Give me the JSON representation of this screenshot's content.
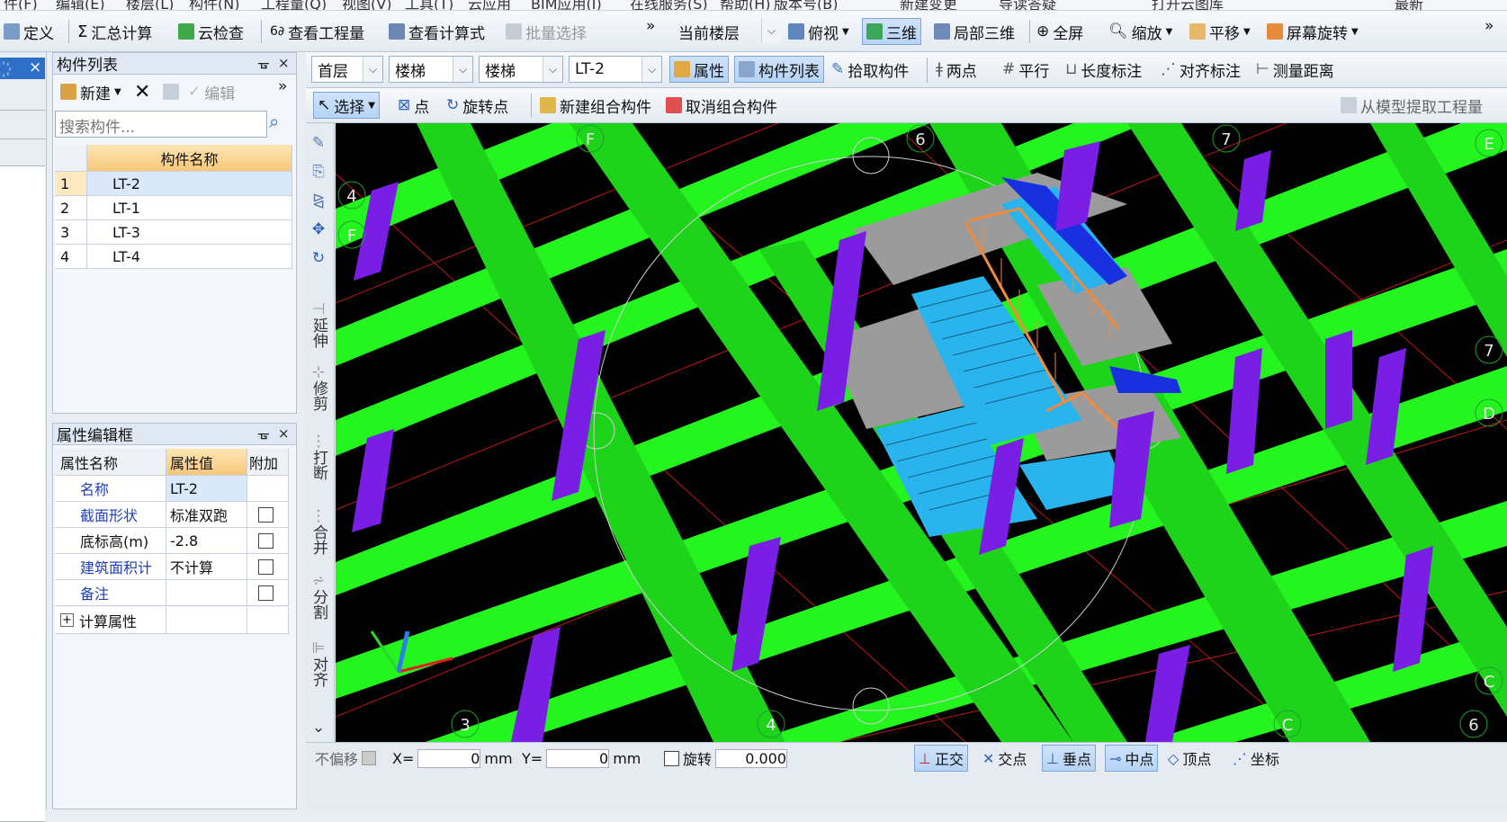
{
  "menubar": {
    "fragments": [
      "件(F)",
      "编辑(E)",
      "楼层(L)",
      "构件(N)",
      "工程量(Q)",
      "视图(V)",
      "工具(T)",
      "云应用",
      "BIM应用(I)",
      "在线服务(S)",
      "帮助(H)",
      "版本号(B)",
      "新建变更",
      "导读答疑",
      "打开云图库",
      "最新"
    ]
  },
  "toolbar1": {
    "define": "定义",
    "sum_calc": "汇总计算",
    "cloud_check": "云检查",
    "view_qty": "查看工程量",
    "view_formula": "查看计算式",
    "batch_select": "批量选择",
    "more": "»",
    "current_floor_label": "当前楼层",
    "top_view": "俯视",
    "three_d": "三维",
    "local_3d": "局部三维",
    "fullscreen": "全屏",
    "zoom": "缩放",
    "pan": "平移",
    "screen_rotate": "屏幕旋转"
  },
  "toolbar2": {
    "floor": "首层",
    "category": "楼梯",
    "type": "楼梯",
    "component": "LT-2",
    "property": "属性",
    "component_list": "构件列表",
    "pick": "拾取构件",
    "two_points": "两点",
    "parallel": "平行",
    "length_dim": "长度标注",
    "align_dim": "对齐标注",
    "measure": "测量距离"
  },
  "toolbar3": {
    "select": "选择",
    "point": "点",
    "rotate_point": "旋转点",
    "new_group": "新建组合构件",
    "cancel_group": "取消组合构件",
    "extract_qty": "从模型提取工程量"
  },
  "component_panel": {
    "title": "构件列表",
    "new": "新建",
    "edit": "编辑",
    "search_placeholder": "搜索构件...",
    "col_name": "构件名称",
    "rows": [
      {
        "idx": "1",
        "name": "LT-2"
      },
      {
        "idx": "2",
        "name": "LT-1"
      },
      {
        "idx": "3",
        "name": "LT-3"
      },
      {
        "idx": "4",
        "name": "LT-4"
      }
    ]
  },
  "property_panel": {
    "title": "属性编辑框",
    "col_name": "属性名称",
    "col_value": "属性值",
    "col_extra": "附加",
    "rows": [
      {
        "name": "名称",
        "value": "LT-2"
      },
      {
        "name": "截面形状",
        "value": "标准双跑"
      },
      {
        "name": "底标高(m)",
        "value": "-2.8"
      },
      {
        "name": "建筑面积计",
        "value": "不计算"
      },
      {
        "name": "备注",
        "value": ""
      }
    ],
    "calc_prop": "计算属性"
  },
  "vertical_tools": {
    "extend": "延伸",
    "trim": "修剪",
    "break": "打断",
    "merge": "合并",
    "split": "分割",
    "align": "对齐"
  },
  "axis_labels": {
    "top": [
      "F",
      "6",
      "7",
      "E"
    ],
    "left": [
      "4",
      "F"
    ],
    "right": [
      "7",
      "D",
      "C"
    ],
    "bottom": [
      "3",
      "4",
      "C",
      "6"
    ]
  },
  "statusbar": {
    "no_offset": "不偏移",
    "x_label": "X=",
    "x_val": "0",
    "y_label": "Y=",
    "y_val": "0",
    "unit": "mm",
    "rotate": "旋转",
    "rotate_val": "0.000",
    "ortho": "正交",
    "snap_point": "交点",
    "vertical": "垂点",
    "midpoint": "中点",
    "vertex": "顶点",
    "coord": "坐标"
  },
  "colors": {
    "beam": "#25f51f",
    "column": "#7a1ee6",
    "slab": "#9b9b9b",
    "stair": "#2ab4ee",
    "rail": "#f08a3c",
    "deep": "#1830e0"
  }
}
